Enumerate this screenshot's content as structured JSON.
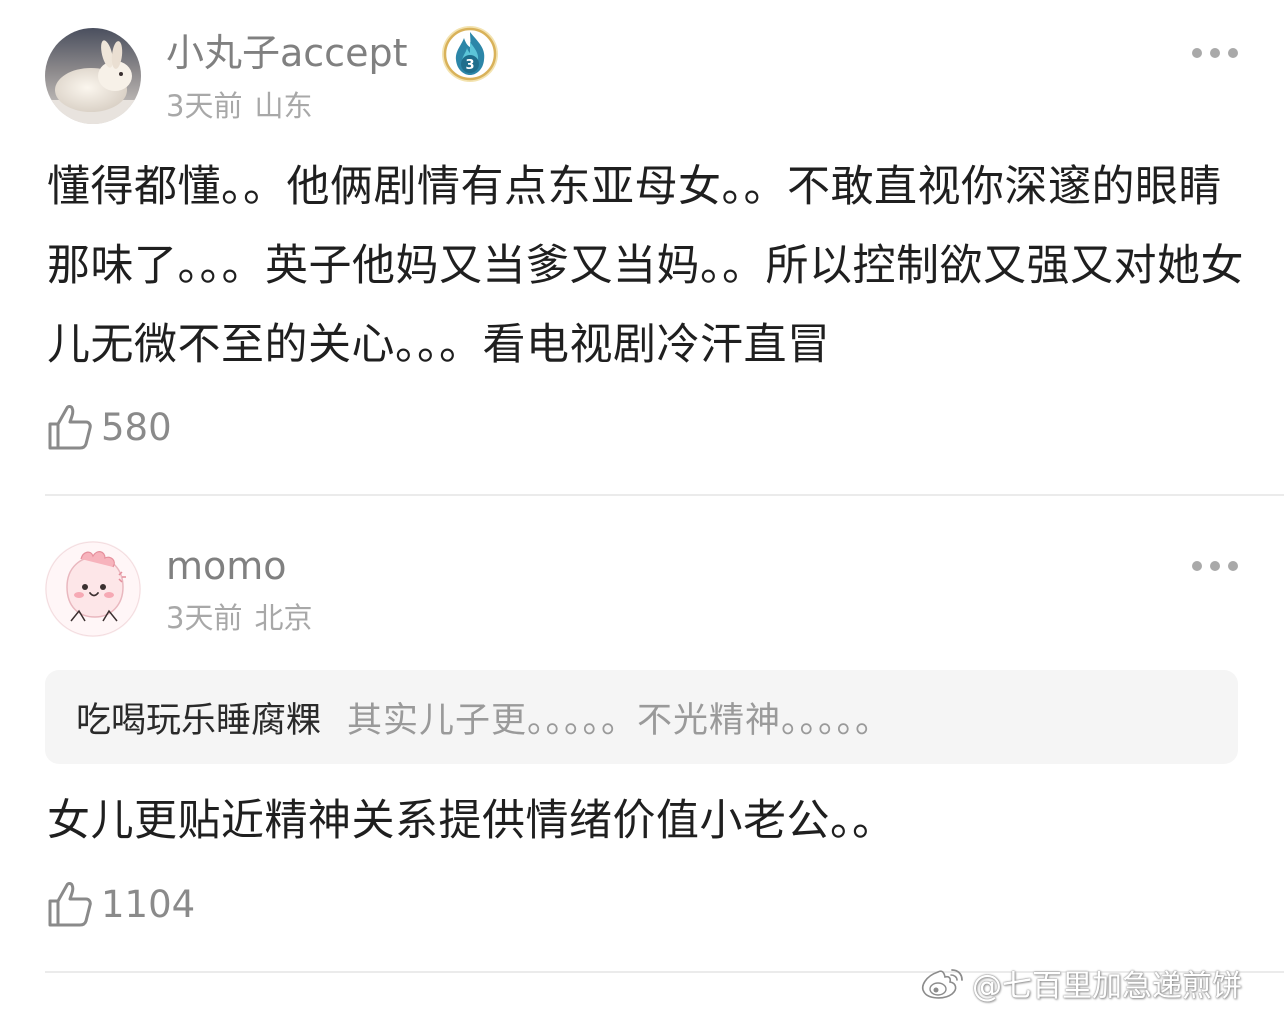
{
  "comments": [
    {
      "username": "小丸子accept",
      "level_badge": "3",
      "time": "3天前",
      "location": "山东",
      "text": "懂得都懂。。他俩剧情有点东亚母女。。不敢直视你深邃的眼睛那味了。。。英子他妈又当爹又当妈。。所以控制欲又强又对她女儿无微不至的关心。。。看电视剧冷汗直冒",
      "likes": "580",
      "avatar_icon": "white-rabbit-avatar",
      "more_icon": "more-dots-icon",
      "like_icon": "thumbs-up-icon"
    },
    {
      "username": "momo",
      "time": "3天前",
      "location": "北京",
      "quote": {
        "author": "吃喝玩乐睡腐粿",
        "text": "其实儿子更。。。。。不光精神。。。。。"
      },
      "text": "女儿更贴近精神关系提供情绪价值小老公。。",
      "likes": "1104",
      "avatar_icon": "pink-cartoon-avatar",
      "more_icon": "more-dots-icon",
      "like_icon": "thumbs-up-icon"
    }
  ],
  "watermark": "@七百里加急递煎饼",
  "colors": {
    "username": "#808080",
    "meta": "#a8a8a8",
    "body_text": "#1f1f1f",
    "badge_teal": "#1f6e8c",
    "badge_gold": "#d9b25a",
    "quote_bg": "#f5f5f5",
    "divider": "#ebebeb"
  }
}
